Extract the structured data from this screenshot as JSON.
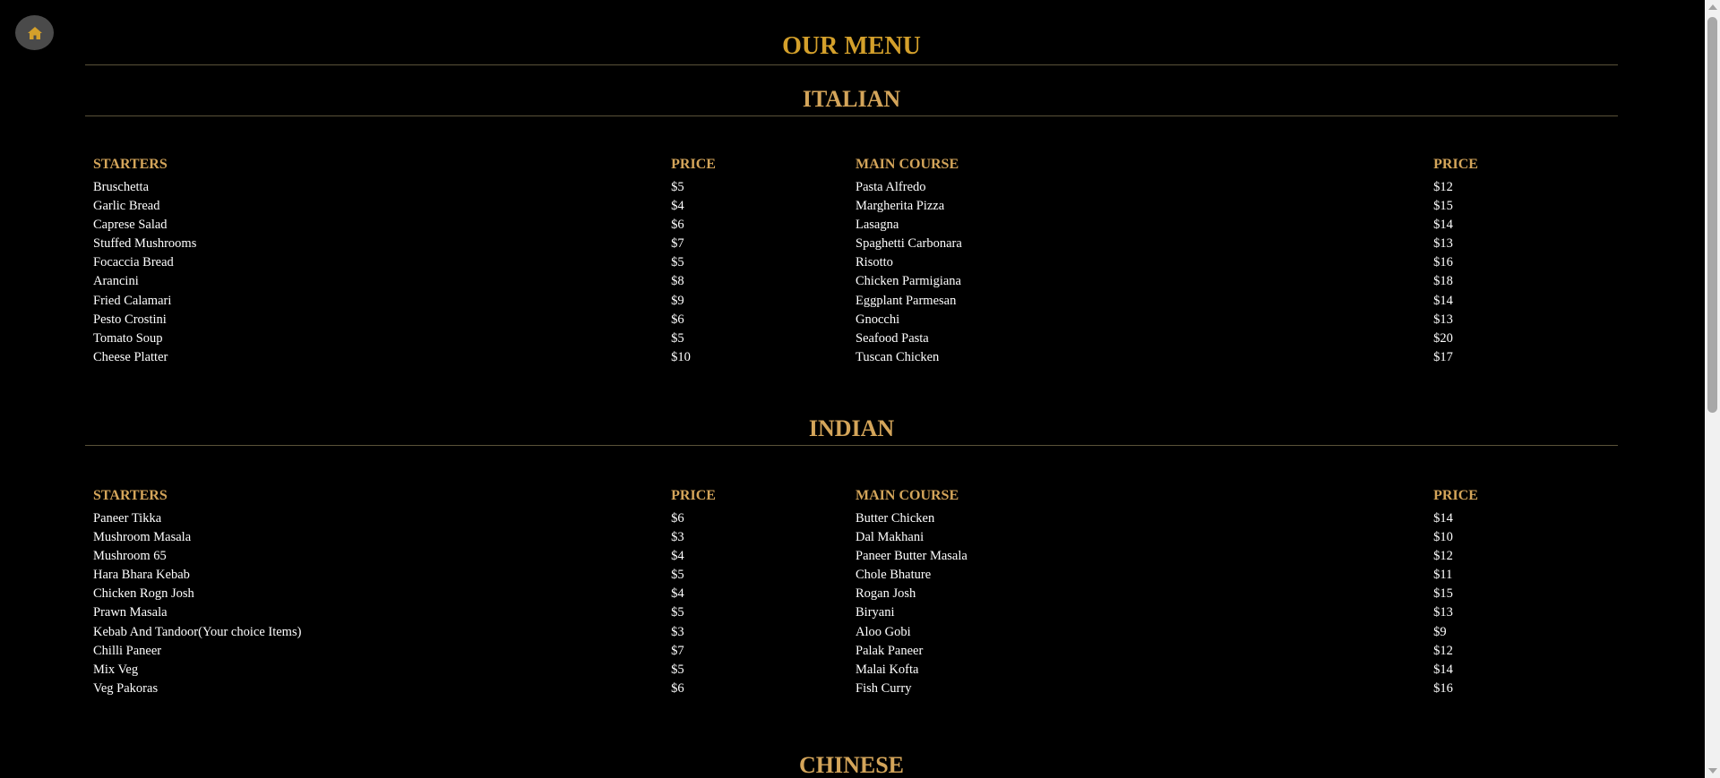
{
  "page": {
    "title": "OUR MENU",
    "home_icon": "home-icon"
  },
  "sections": {
    "italian": {
      "title": "ITALIAN",
      "starters_header": "STARTERS",
      "price_header": "PRICE",
      "main_header": "MAIN COURSE",
      "main_price_header": "PRICE",
      "starters": [
        {
          "name": "Bruschetta",
          "price": "$5"
        },
        {
          "name": "Garlic Bread",
          "price": "$4"
        },
        {
          "name": "Caprese Salad",
          "price": "$6"
        },
        {
          "name": "Stuffed Mushrooms",
          "price": "$7"
        },
        {
          "name": "Focaccia Bread",
          "price": "$5"
        },
        {
          "name": "Arancini",
          "price": "$8"
        },
        {
          "name": "Fried Calamari",
          "price": "$9"
        },
        {
          "name": "Pesto Crostini",
          "price": "$6"
        },
        {
          "name": "Tomato Soup",
          "price": "$5"
        },
        {
          "name": "Cheese Platter",
          "price": "$10"
        }
      ],
      "mains": [
        {
          "name": "Pasta Alfredo",
          "price": "$12"
        },
        {
          "name": "Margherita Pizza",
          "price": "$15"
        },
        {
          "name": "Lasagna",
          "price": "$14"
        },
        {
          "name": "Spaghetti Carbonara",
          "price": "$13"
        },
        {
          "name": "Risotto",
          "price": "$16"
        },
        {
          "name": "Chicken Parmigiana",
          "price": "$18"
        },
        {
          "name": "Eggplant Parmesan",
          "price": "$14"
        },
        {
          "name": "Gnocchi",
          "price": "$13"
        },
        {
          "name": "Seafood Pasta",
          "price": "$20"
        },
        {
          "name": "Tuscan Chicken",
          "price": "$17"
        }
      ]
    },
    "indian": {
      "title": "INDIAN",
      "starters_header": "STARTERS",
      "price_header": "PRICE",
      "main_header": "MAIN COURSE",
      "main_price_header": "PRICE",
      "starters": [
        {
          "name": "Paneer Tikka",
          "price": "$6"
        },
        {
          "name": "Mushroom Masala",
          "price": "$3"
        },
        {
          "name": "Mushroom 65",
          "price": "$4"
        },
        {
          "name": "Hara Bhara Kebab",
          "price": "$5"
        },
        {
          "name": "Chicken Rogn Josh",
          "price": "$4"
        },
        {
          "name": "Prawn Masala",
          "price": "$5"
        },
        {
          "name": "Kebab And Tandoor(Your choice Items)",
          "price": "$3"
        },
        {
          "name": "Chilli Paneer",
          "price": "$7"
        },
        {
          "name": "Mix Veg",
          "price": "$5"
        },
        {
          "name": "Veg Pakoras",
          "price": "$6"
        }
      ],
      "mains": [
        {
          "name": "Butter Chicken",
          "price": "$14"
        },
        {
          "name": "Dal Makhani",
          "price": "$10"
        },
        {
          "name": "Paneer Butter Masala",
          "price": "$12"
        },
        {
          "name": "Chole Bhature",
          "price": "$11"
        },
        {
          "name": "Rogan Josh",
          "price": "$15"
        },
        {
          "name": "Biryani",
          "price": "$13"
        },
        {
          "name": "Aloo Gobi",
          "price": "$9"
        },
        {
          "name": "Palak Paneer",
          "price": "$12"
        },
        {
          "name": "Malai Kofta",
          "price": "$14"
        },
        {
          "name": "Fish Curry",
          "price": "$16"
        }
      ]
    },
    "chinese": {
      "title": "CHINESE"
    }
  },
  "colors": {
    "background": "#000000",
    "title": "#d4a02b",
    "section_heading": "#d4a55a",
    "text": "#ffffff",
    "divider": "#5a5239"
  }
}
